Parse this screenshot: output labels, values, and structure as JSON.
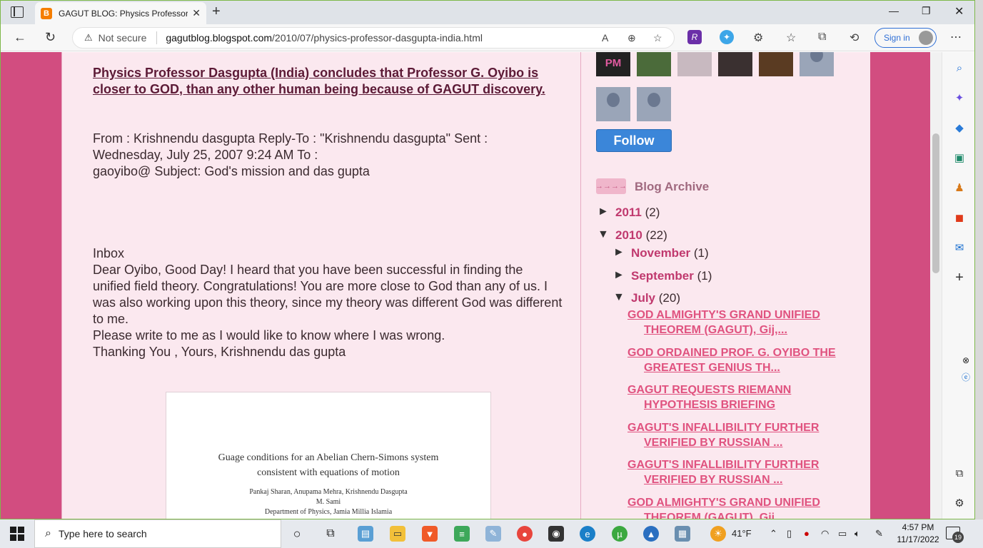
{
  "browser": {
    "tab_title": "GAGUT BLOG: Physics Professor D",
    "tab_favicon": "B",
    "not_secure": "Not secure",
    "url_host": "gagutblog.blogspot.com",
    "url_path": "/2010/07/physics-professor-dasgupta-india.html",
    "sign_in": "Sign in",
    "ext_letter": "R"
  },
  "post": {
    "title": "Physics Professor Dasgupta (India) concludes that Professor G. Oyibo is closer to GOD, than any other human being because of GAGUT discovery.",
    "header_lines": [
      "From : Krishnendu dasgupta Reply-To : \"Krishnendu dasgupta\" Sent :",
      "Wednesday, July 25, 2007 9:24 AM To :",
      "gaoyibo@ Subject: God's mission and das gupta"
    ],
    "inbox": "Inbox",
    "body": "Dear Oyibo, Good Day! I heard that you have been successful in finding the unified field theory. Congratulations! You are more close to God than any of us. I was also working upon this theory, since my theory was different God was different to me.",
    "body2": "Please write to me as I would like to know where I was wrong.",
    "signoff": "Thanking You , Yours, Krishnendu das gupta",
    "paper": {
      "title1": "Guage conditions for an Abelian Chern-Simons system",
      "title2": "consistent with equations of motion",
      "authors": "Pankaj Sharan, Anupama Mehra, Krishnendu Dasgupta",
      "author2": "M. Sami",
      "dept": "Department of Physics, Jamia Millia Islamia"
    }
  },
  "sidebar": {
    "thumb_pm": "PM",
    "follow": "Follow",
    "archive_title": "Blog Archive",
    "archive_icon": "→→→→",
    "years": [
      {
        "year": "2011",
        "count": "(2)",
        "toggle": "►"
      },
      {
        "year": "2010",
        "count": "(22)",
        "toggle": "▼"
      }
    ],
    "months": [
      {
        "month": "November",
        "count": "(1)",
        "toggle": "►"
      },
      {
        "month": "September",
        "count": "(1)",
        "toggle": "►"
      },
      {
        "month": "July",
        "count": "(20)",
        "toggle": "▼"
      }
    ],
    "posts": [
      {
        "l1": "GOD ALMIGHTY'S GRAND UNIFIED",
        "l2": "THEOREM (GAGUT), Gij,..."
      },
      {
        "l1": "GOD ORDAINED PROF. G. OYIBO THE",
        "l2": "GREATEST GENIUS TH..."
      },
      {
        "l1": "GAGUT REQUESTS RIEMANN",
        "l2": "HYPOTHESIS BRIEFING"
      },
      {
        "l1": "GAGUT'S INFALLIBILITY FURTHER",
        "l2": "VERIFIED BY RUSSIAN ..."
      },
      {
        "l1": "GAGUT'S INFALLIBILITY FURTHER",
        "l2": "VERIFIED BY RUSSIAN ..."
      },
      {
        "l1": "GOD ALMIGHTY'S GRAND UNIFIED",
        "l2": "THEOREM (GAGUT), Gij,..."
      }
    ]
  },
  "taskbar": {
    "search_placeholder": "Type here to search",
    "weather": "41°F",
    "time": "4:57 PM",
    "date": "11/17/2022",
    "notif_count": "19"
  }
}
